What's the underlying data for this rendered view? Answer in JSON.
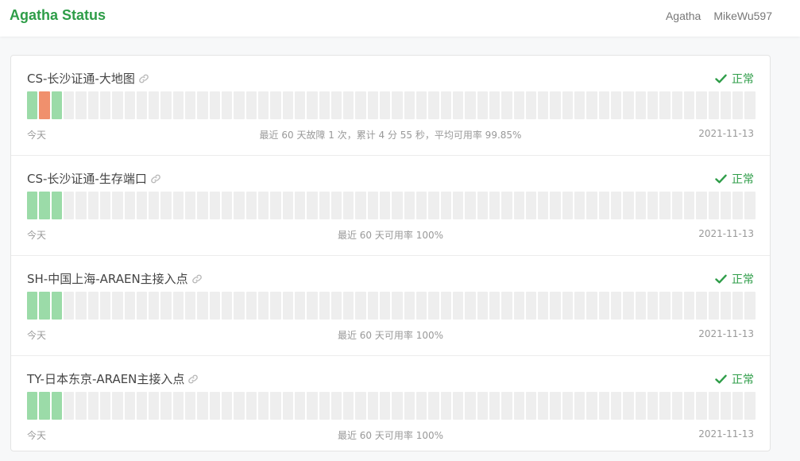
{
  "header": {
    "brand": "Agatha Status",
    "nav": [
      "Agatha",
      "MikeWu597"
    ]
  },
  "colors": {
    "up": "#9bdba8",
    "down": "#f0906d",
    "none": "#eeeeee",
    "brand": "#2e9d48"
  },
  "monitors": [
    {
      "name": "CS-长沙证通-大地图",
      "status": "正常",
      "days": [
        "up",
        "down",
        "up"
      ],
      "today_label": "今天",
      "summary": "最近 60 天故障 1 次，累计 4 分 55 秒，平均可用率 99.85%",
      "date": "2021-11-13"
    },
    {
      "name": "CS-长沙证通-生存端口",
      "status": "正常",
      "days": [
        "up",
        "up",
        "up"
      ],
      "today_label": "今天",
      "summary": "最近 60 天可用率 100%",
      "date": "2021-11-13"
    },
    {
      "name": "SH-中国上海-ARAEN主接入点",
      "status": "正常",
      "days": [
        "up",
        "up",
        "up"
      ],
      "today_label": "今天",
      "summary": "最近 60 天可用率 100%",
      "date": "2021-11-13"
    },
    {
      "name": "TY-日本东京-ARAEN主接入点",
      "status": "正常",
      "days": [
        "up",
        "up",
        "up"
      ],
      "today_label": "今天",
      "summary": "最近 60 天可用率 100%",
      "date": "2021-11-13"
    }
  ]
}
